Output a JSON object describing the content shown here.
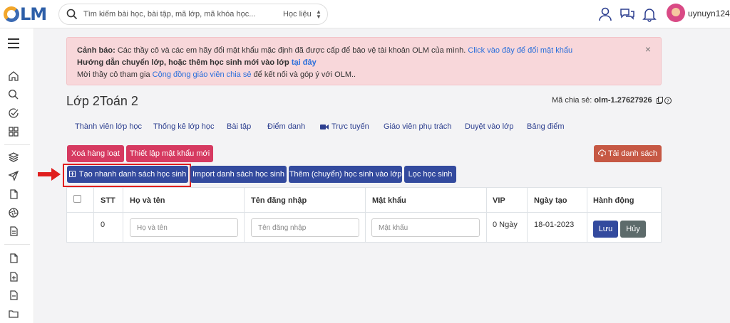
{
  "header": {
    "logo_text": "LM",
    "search_placeholder": "Tìm kiếm bài học, bài tập, mã lớp, mã khóa học...",
    "search_category": "Học liệu",
    "username": "uynuyn124"
  },
  "alert": {
    "line1_bold": "Cảnh báo:",
    "line1_text": " Các thầy cô và các em hãy đổi mật khẩu mặc định đã được cấp để bảo vệ tài khoản OLM của mình. ",
    "line1_link": "Click vào đây để đổi mật khẩu",
    "line2_bold": "Hướng dẫn chuyển lớp, hoặc thêm học sinh mới vào lớp ",
    "line2_link": "tại đây",
    "line3_text": "Mời thầy cô tham gia ",
    "line3_link": "Cộng đồng giáo viên chia sẻ",
    "line3_tail": " để kết nối và góp ý với OLM..",
    "close": "×"
  },
  "class": {
    "title": "Lớp 2Toán 2",
    "share_label": "Mã chia sẻ: ",
    "share_code": "olm-1.27627926"
  },
  "tabs": [
    {
      "label": "Thành viên lớp học"
    },
    {
      "label": "Thống kê lớp học"
    },
    {
      "label": "Bài tập"
    },
    {
      "label": "Điểm danh"
    },
    {
      "label": "Trực tuyến"
    },
    {
      "label": "Giáo viên phụ trách"
    },
    {
      "label": "Duyệt vào lớp"
    },
    {
      "label": "Bảng điểm"
    }
  ],
  "actions": {
    "delete_bulk": "Xoá hàng loạt",
    "reset_password": "Thiết lập mật khẩu mới",
    "download_list": "Tải danh sách",
    "quick_create": "Tạo nhanh danh sách học sinh",
    "import_list": "Import danh sách học sinh",
    "add_student": "Thêm (chuyển) học sinh vào lớp",
    "filter_student": "Lọc học sinh"
  },
  "table": {
    "headers": [
      "STT",
      "Họ và tên",
      "Tên đăng nhập",
      "Mật khẩu",
      "VIP",
      "Ngày tạo",
      "Hành động"
    ],
    "row": {
      "stt": "0",
      "name_placeholder": "Họ và tên",
      "username_placeholder": "Tên đăng nhập",
      "password_placeholder": "Mật khẩu",
      "vip": "0 Ngày",
      "created": "18-01-2023",
      "save": "Lưu",
      "cancel": "Hủy"
    }
  },
  "colors": {
    "primary": "#334a9e",
    "danger": "#d63a61",
    "download": "#c65844",
    "alert_bg": "#f8d7da",
    "highlight": "#e01e1e"
  }
}
